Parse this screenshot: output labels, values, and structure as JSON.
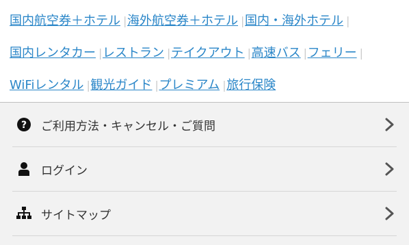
{
  "links": {
    "row1": [
      "国内航空券＋ホテル",
      "海外航空券＋ホテル",
      "国内・海外ホテル"
    ],
    "row2": [
      "国内レンタカー",
      "レストラン",
      "テイクアウト",
      "高速バス",
      "フェリー"
    ],
    "row3": [
      "WiFiレンタル",
      "観光ガイド",
      "プレミアム",
      "旅行保険"
    ]
  },
  "menu": {
    "items": [
      {
        "label": "ご利用方法・キャンセル・ご質問",
        "icon": "question-circle-icon"
      },
      {
        "label": "ログイン",
        "icon": "user-icon"
      },
      {
        "label": "サイトマップ",
        "icon": "sitemap-icon"
      }
    ]
  },
  "colors": {
    "link": "#2a86c8",
    "menu_bg": "#f2f2f2",
    "text": "#333333"
  }
}
